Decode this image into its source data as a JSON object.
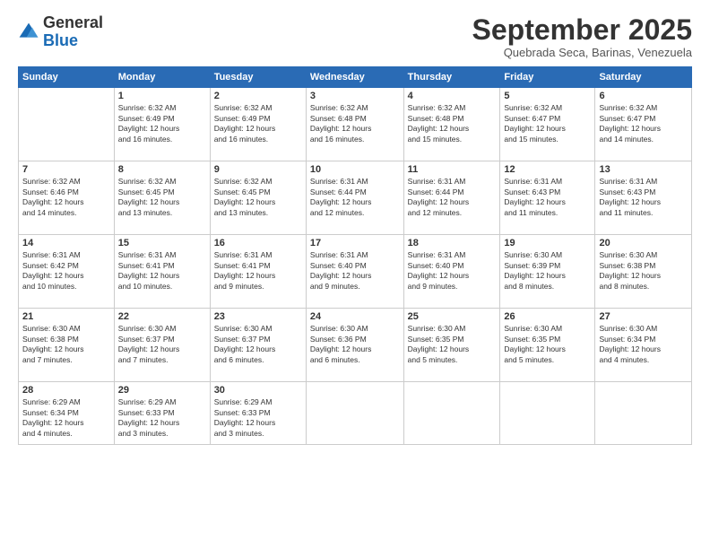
{
  "header": {
    "logo": {
      "line1": "General",
      "line2": "Blue"
    },
    "title": "September 2025",
    "subtitle": "Quebrada Seca, Barinas, Venezuela"
  },
  "days_of_week": [
    "Sunday",
    "Monday",
    "Tuesday",
    "Wednesday",
    "Thursday",
    "Friday",
    "Saturday"
  ],
  "weeks": [
    [
      {
        "day": "",
        "info": ""
      },
      {
        "day": "1",
        "info": "Sunrise: 6:32 AM\nSunset: 6:49 PM\nDaylight: 12 hours\nand 16 minutes."
      },
      {
        "day": "2",
        "info": "Sunrise: 6:32 AM\nSunset: 6:49 PM\nDaylight: 12 hours\nand 16 minutes."
      },
      {
        "day": "3",
        "info": "Sunrise: 6:32 AM\nSunset: 6:48 PM\nDaylight: 12 hours\nand 16 minutes."
      },
      {
        "day": "4",
        "info": "Sunrise: 6:32 AM\nSunset: 6:48 PM\nDaylight: 12 hours\nand 15 minutes."
      },
      {
        "day": "5",
        "info": "Sunrise: 6:32 AM\nSunset: 6:47 PM\nDaylight: 12 hours\nand 15 minutes."
      },
      {
        "day": "6",
        "info": "Sunrise: 6:32 AM\nSunset: 6:47 PM\nDaylight: 12 hours\nand 14 minutes."
      }
    ],
    [
      {
        "day": "7",
        "info": "Sunrise: 6:32 AM\nSunset: 6:46 PM\nDaylight: 12 hours\nand 14 minutes."
      },
      {
        "day": "8",
        "info": "Sunrise: 6:32 AM\nSunset: 6:45 PM\nDaylight: 12 hours\nand 13 minutes."
      },
      {
        "day": "9",
        "info": "Sunrise: 6:32 AM\nSunset: 6:45 PM\nDaylight: 12 hours\nand 13 minutes."
      },
      {
        "day": "10",
        "info": "Sunrise: 6:31 AM\nSunset: 6:44 PM\nDaylight: 12 hours\nand 12 minutes."
      },
      {
        "day": "11",
        "info": "Sunrise: 6:31 AM\nSunset: 6:44 PM\nDaylight: 12 hours\nand 12 minutes."
      },
      {
        "day": "12",
        "info": "Sunrise: 6:31 AM\nSunset: 6:43 PM\nDaylight: 12 hours\nand 11 minutes."
      },
      {
        "day": "13",
        "info": "Sunrise: 6:31 AM\nSunset: 6:43 PM\nDaylight: 12 hours\nand 11 minutes."
      }
    ],
    [
      {
        "day": "14",
        "info": "Sunrise: 6:31 AM\nSunset: 6:42 PM\nDaylight: 12 hours\nand 10 minutes."
      },
      {
        "day": "15",
        "info": "Sunrise: 6:31 AM\nSunset: 6:41 PM\nDaylight: 12 hours\nand 10 minutes."
      },
      {
        "day": "16",
        "info": "Sunrise: 6:31 AM\nSunset: 6:41 PM\nDaylight: 12 hours\nand 9 minutes."
      },
      {
        "day": "17",
        "info": "Sunrise: 6:31 AM\nSunset: 6:40 PM\nDaylight: 12 hours\nand 9 minutes."
      },
      {
        "day": "18",
        "info": "Sunrise: 6:31 AM\nSunset: 6:40 PM\nDaylight: 12 hours\nand 9 minutes."
      },
      {
        "day": "19",
        "info": "Sunrise: 6:30 AM\nSunset: 6:39 PM\nDaylight: 12 hours\nand 8 minutes."
      },
      {
        "day": "20",
        "info": "Sunrise: 6:30 AM\nSunset: 6:38 PM\nDaylight: 12 hours\nand 8 minutes."
      }
    ],
    [
      {
        "day": "21",
        "info": "Sunrise: 6:30 AM\nSunset: 6:38 PM\nDaylight: 12 hours\nand 7 minutes."
      },
      {
        "day": "22",
        "info": "Sunrise: 6:30 AM\nSunset: 6:37 PM\nDaylight: 12 hours\nand 7 minutes."
      },
      {
        "day": "23",
        "info": "Sunrise: 6:30 AM\nSunset: 6:37 PM\nDaylight: 12 hours\nand 6 minutes."
      },
      {
        "day": "24",
        "info": "Sunrise: 6:30 AM\nSunset: 6:36 PM\nDaylight: 12 hours\nand 6 minutes."
      },
      {
        "day": "25",
        "info": "Sunrise: 6:30 AM\nSunset: 6:35 PM\nDaylight: 12 hours\nand 5 minutes."
      },
      {
        "day": "26",
        "info": "Sunrise: 6:30 AM\nSunset: 6:35 PM\nDaylight: 12 hours\nand 5 minutes."
      },
      {
        "day": "27",
        "info": "Sunrise: 6:30 AM\nSunset: 6:34 PM\nDaylight: 12 hours\nand 4 minutes."
      }
    ],
    [
      {
        "day": "28",
        "info": "Sunrise: 6:29 AM\nSunset: 6:34 PM\nDaylight: 12 hours\nand 4 minutes."
      },
      {
        "day": "29",
        "info": "Sunrise: 6:29 AM\nSunset: 6:33 PM\nDaylight: 12 hours\nand 3 minutes."
      },
      {
        "day": "30",
        "info": "Sunrise: 6:29 AM\nSunset: 6:33 PM\nDaylight: 12 hours\nand 3 minutes."
      },
      {
        "day": "",
        "info": ""
      },
      {
        "day": "",
        "info": ""
      },
      {
        "day": "",
        "info": ""
      },
      {
        "day": "",
        "info": ""
      }
    ]
  ]
}
